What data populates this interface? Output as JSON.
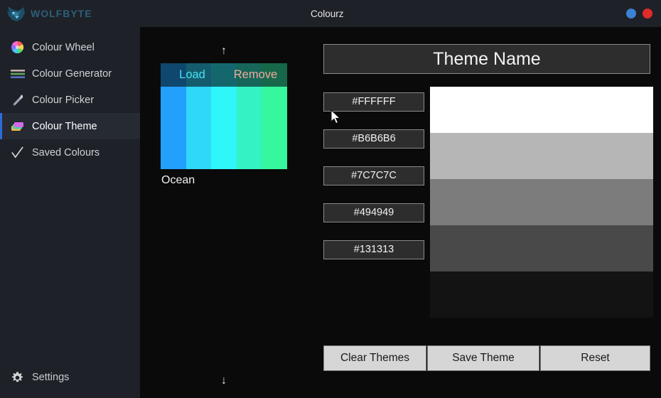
{
  "window": {
    "brand": "WOLFBYTE",
    "title": "Colourz",
    "brand_icon": "wolf-head-icon",
    "controls": [
      {
        "name": "minimize",
        "label": "",
        "color": "#3b82d4"
      },
      {
        "name": "close",
        "label": "",
        "color": "#e02b28"
      }
    ]
  },
  "sidebar": {
    "items": [
      {
        "label": "Colour Wheel",
        "icon": "colour-wheel-icon",
        "active": false
      },
      {
        "label": "Colour Generator",
        "icon": "sliders-icon",
        "active": false
      },
      {
        "label": "Colour Picker",
        "icon": "eyedropper-icon",
        "active": false
      },
      {
        "label": "Colour Theme",
        "icon": "colour-cards-icon",
        "active": true
      },
      {
        "label": "Saved Colours",
        "icon": "checkmark-icon",
        "active": false
      }
    ],
    "settings": {
      "label": "Settings",
      "icon": "gear-icon"
    },
    "active_indicator_color": "#2f6bd8"
  },
  "themes_panel": {
    "scroll_up": "↑",
    "scroll_down": "↓",
    "themes": [
      {
        "name": "Ocean",
        "load_label": "Load",
        "remove_label": "Remove",
        "colors": [
          "#22A0FC",
          "#2FD7F9",
          "#2FF6F9",
          "#34F2C4",
          "#36F79D"
        ]
      }
    ]
  },
  "editor": {
    "theme_name_value": "Theme Name",
    "theme_name_placeholder": "Theme Name",
    "colours": [
      {
        "hex": "#FFFFFF"
      },
      {
        "hex": "#B6B6B6"
      },
      {
        "hex": "#7C7C7C"
      },
      {
        "hex": "#494949"
      },
      {
        "hex": "#131313"
      }
    ],
    "buttons": {
      "clear": "Clear Themes",
      "save": "Save Theme",
      "reset": "Reset"
    }
  }
}
